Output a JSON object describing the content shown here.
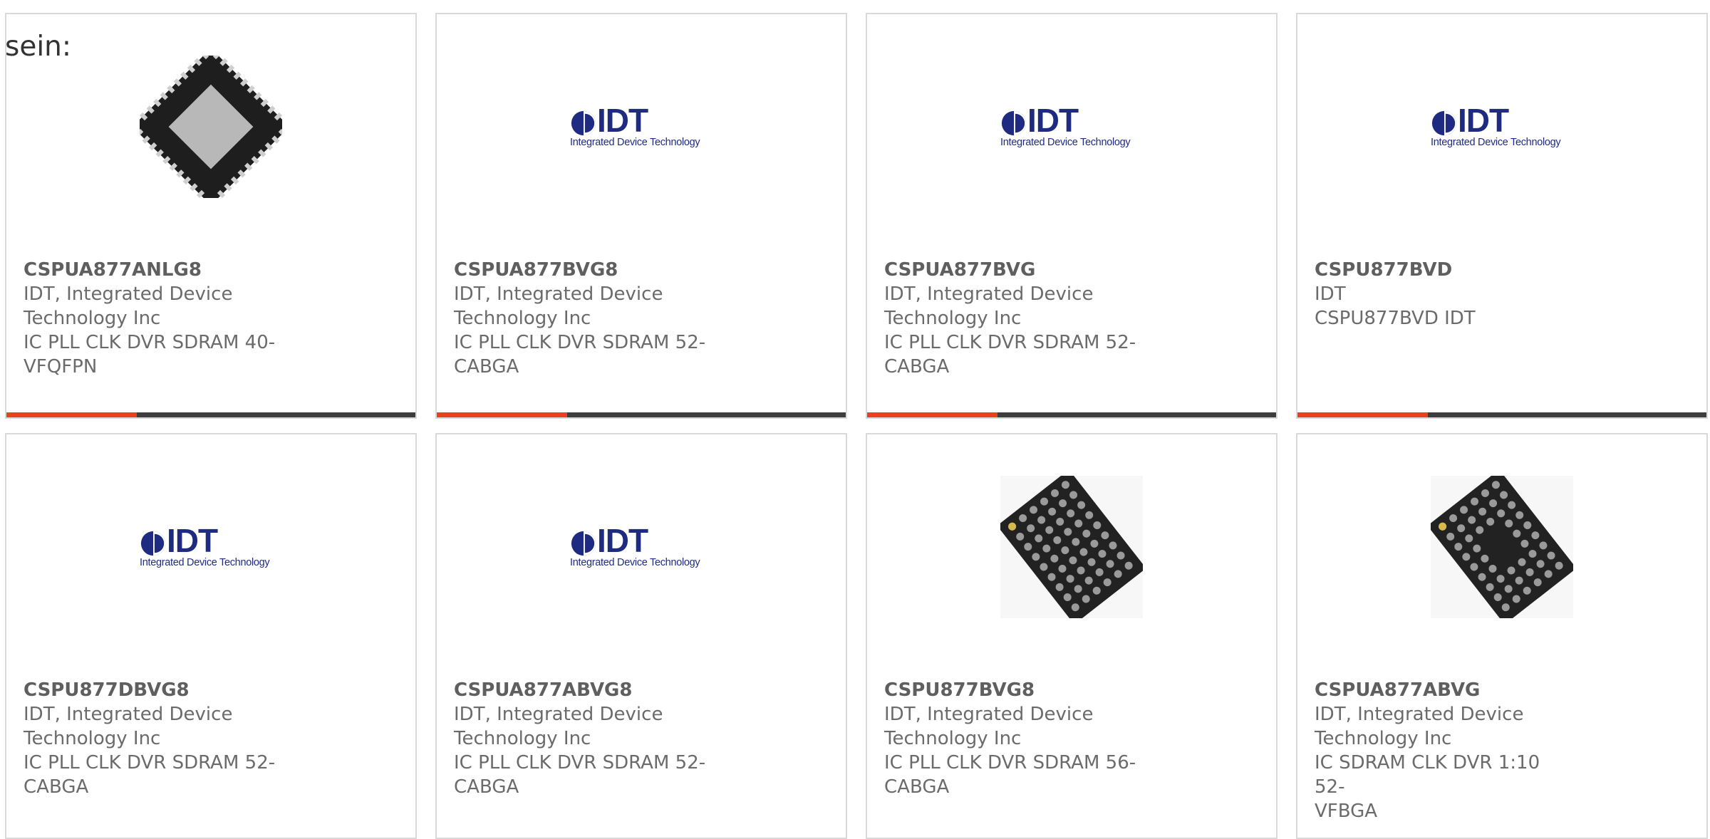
{
  "lead_text": "sein:",
  "colors": {
    "accent_bar": "#e8411b",
    "dark_bar": "#3d3d3d",
    "card_border": "#d9d9d9",
    "text": "#6b6b6b",
    "logo_blue": "#1f2b80"
  },
  "logo": {
    "word": "IDT",
    "tagline": "Integrated Device Technology"
  },
  "products": [
    {
      "part_number": "CSPUA877ANLG8",
      "manufacturer_line1": "IDT, Integrated Device",
      "manufacturer_line2": "Technology Inc",
      "description_line1": "IC PLL CLK DVR SDRAM 40-",
      "description_line2": "VFQFPN",
      "image": "qfn-chip-photo"
    },
    {
      "part_number": "CSPUA877BVG8",
      "manufacturer_line1": "IDT, Integrated Device",
      "manufacturer_line2": "Technology Inc",
      "description_line1": "IC PLL CLK DVR SDRAM 52-",
      "description_line2": "CABGA",
      "image": "idt-logo"
    },
    {
      "part_number": "CSPUA877BVG",
      "manufacturer_line1": "IDT, Integrated Device",
      "manufacturer_line2": "Technology Inc",
      "description_line1": "IC PLL CLK DVR SDRAM 52-",
      "description_line2": "CABGA",
      "image": "idt-logo"
    },
    {
      "part_number": "CSPU877BVD",
      "manufacturer_line1": "IDT",
      "manufacturer_line2": "CSPU877BVD IDT",
      "description_line1": "",
      "description_line2": "",
      "image": "idt-logo"
    },
    {
      "part_number": "CSPU877DBVG8",
      "manufacturer_line1": "IDT, Integrated Device",
      "manufacturer_line2": "Technology Inc",
      "description_line1": "IC PLL CLK DVR SDRAM 52-",
      "description_line2": "CABGA",
      "image": "idt-logo"
    },
    {
      "part_number": "CSPUA877ABVG8",
      "manufacturer_line1": "IDT, Integrated Device",
      "manufacturer_line2": "Technology Inc",
      "description_line1": "IC PLL CLK DVR SDRAM 52-",
      "description_line2": "CABGA",
      "image": "idt-logo"
    },
    {
      "part_number": "CSPU877BVG8",
      "manufacturer_line1": "IDT, Integrated Device",
      "manufacturer_line2": "Technology Inc",
      "description_line1": "IC PLL CLK DVR SDRAM 56-",
      "description_line2": "CABGA",
      "image": "bga-chip-photo"
    },
    {
      "part_number": "CSPUA877ABVG",
      "manufacturer_line1": "IDT, Integrated Device",
      "manufacturer_line2": "Technology Inc",
      "description_line1": "IC SDRAM CLK DVR 1:10 52-",
      "description_line2": "VFBGA",
      "image": "bga-chip-photo-2"
    }
  ]
}
